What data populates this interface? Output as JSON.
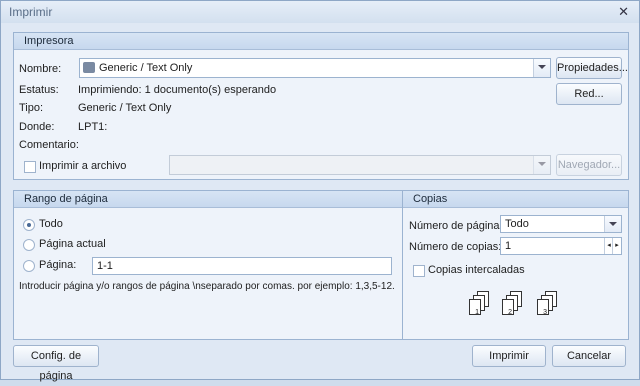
{
  "window": {
    "title": "Imprimir"
  },
  "printer": {
    "group_title": "Impresora",
    "name_label": "Nombre:",
    "name_value": "Generic / Text Only",
    "status_label": "Estatus:",
    "status_value": "Imprimiendo: 1 documento(s) esperando",
    "type_label": "Tipo:",
    "type_value": "Generic / Text Only",
    "where_label": "Donde:",
    "where_value": "LPT1:",
    "comment_label": "Comentario:",
    "print_to_file_label": "Imprimir a archivo",
    "properties_label": "Propiedades...",
    "network_label": "Red...",
    "browse_label": "Navegador..."
  },
  "range": {
    "group_title": "Rango de página",
    "all_label": "Todo",
    "current_label": "Página actual",
    "pages_label": "Página:",
    "pages_value": "1-1",
    "hint": "Introducir página y/o rangos de página \\nseparado por comas. por ejemplo: 1,3,5-12."
  },
  "copies": {
    "group_title": "Copias",
    "num_pages_label": "Número de páginas:",
    "num_pages_value": "Todo",
    "num_copies_label": "Número de copias:",
    "num_copies_value": "1",
    "collate_label": "Copias intercaladas",
    "collate_digits": [
      "1",
      "2",
      "3"
    ]
  },
  "footer": {
    "page_setup_label": "Config. de página",
    "print_label": "Imprimir",
    "cancel_label": "Cancelar"
  }
}
